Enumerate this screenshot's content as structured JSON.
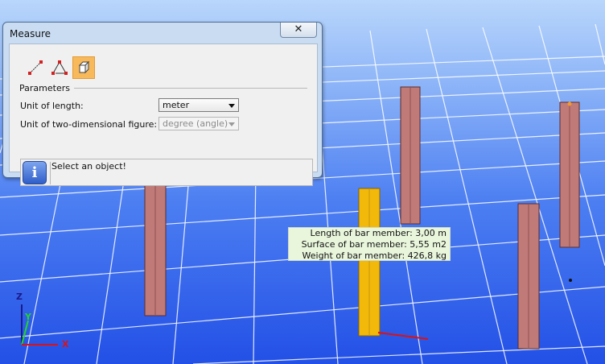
{
  "dialog": {
    "title": "Measure",
    "close_symbol": "✕",
    "tools": [
      {
        "name": "measure-distance-icon"
      },
      {
        "name": "measure-angle-icon"
      },
      {
        "name": "measure-object-icon",
        "active": true
      }
    ],
    "section_label": "Parameters",
    "unit_length_label": "Unit of length:",
    "unit_length_value": "meter",
    "unit_2d_label": "Unit of two-dimensional figure:",
    "unit_2d_value": "degree (angle)",
    "info_icon_text": "i",
    "info_message": "Select an object!"
  },
  "tooltip": {
    "length": "Length of bar member: 3,00 m",
    "surface": "Surface of bar member: 5,55 m2",
    "weight": "Weight of bar member: 426,8 kg"
  },
  "axes": {
    "z_label": "Z",
    "y_label": "Y",
    "x_label": "X",
    "z_color": "#1a1a8c",
    "y_color": "#23d623",
    "x_color": "#e01010"
  },
  "colors": {
    "member": "#c07a78",
    "member_selected": "#f2b90a",
    "accent_button": "#f7b95a"
  }
}
